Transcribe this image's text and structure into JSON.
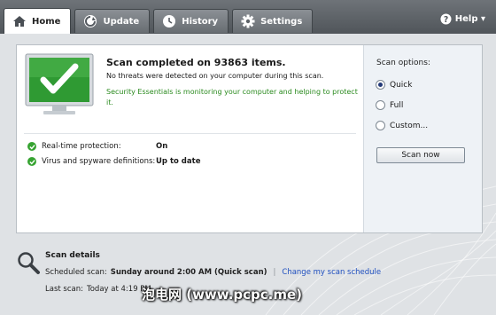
{
  "tabs": [
    {
      "label": "Home",
      "icon": "home-icon",
      "active": true
    },
    {
      "label": "Update",
      "icon": "update-icon",
      "active": false
    },
    {
      "label": "History",
      "icon": "history-icon",
      "active": false
    },
    {
      "label": "Settings",
      "icon": "settings-icon",
      "active": false
    }
  ],
  "help": {
    "label": "Help ▾",
    "icon": "help-icon"
  },
  "status": {
    "headline": "Scan completed on 93863 items.",
    "no_threats": "No threats were detected on your computer during this scan.",
    "monitoring": "Security Essentials is monitoring your computer and helping to protect it.",
    "rows": [
      {
        "label": "Real-time protection:",
        "value": "On"
      },
      {
        "label": "Virus and spyware definitions:",
        "value": "Up to date"
      }
    ]
  },
  "scan_options": {
    "title": "Scan options:",
    "options": [
      {
        "label": "Quick",
        "selected": true
      },
      {
        "label": "Full",
        "selected": false
      },
      {
        "label": "Custom...",
        "selected": false
      }
    ],
    "button_label": "Scan now"
  },
  "details": {
    "title": "Scan details",
    "scheduled_label": "Scheduled scan:",
    "scheduled_value": "Sunday around 2:00 AM (Quick scan)",
    "change_link": "Change my scan schedule",
    "last_label": "Last scan:",
    "last_value": "Today at 4:19 PM"
  },
  "watermark": "泡电网 (www.pcpc.me)",
  "colors": {
    "accent_green": "#36a331",
    "link_blue": "#1f4fbf",
    "monitor_green": "#2f9a33"
  }
}
